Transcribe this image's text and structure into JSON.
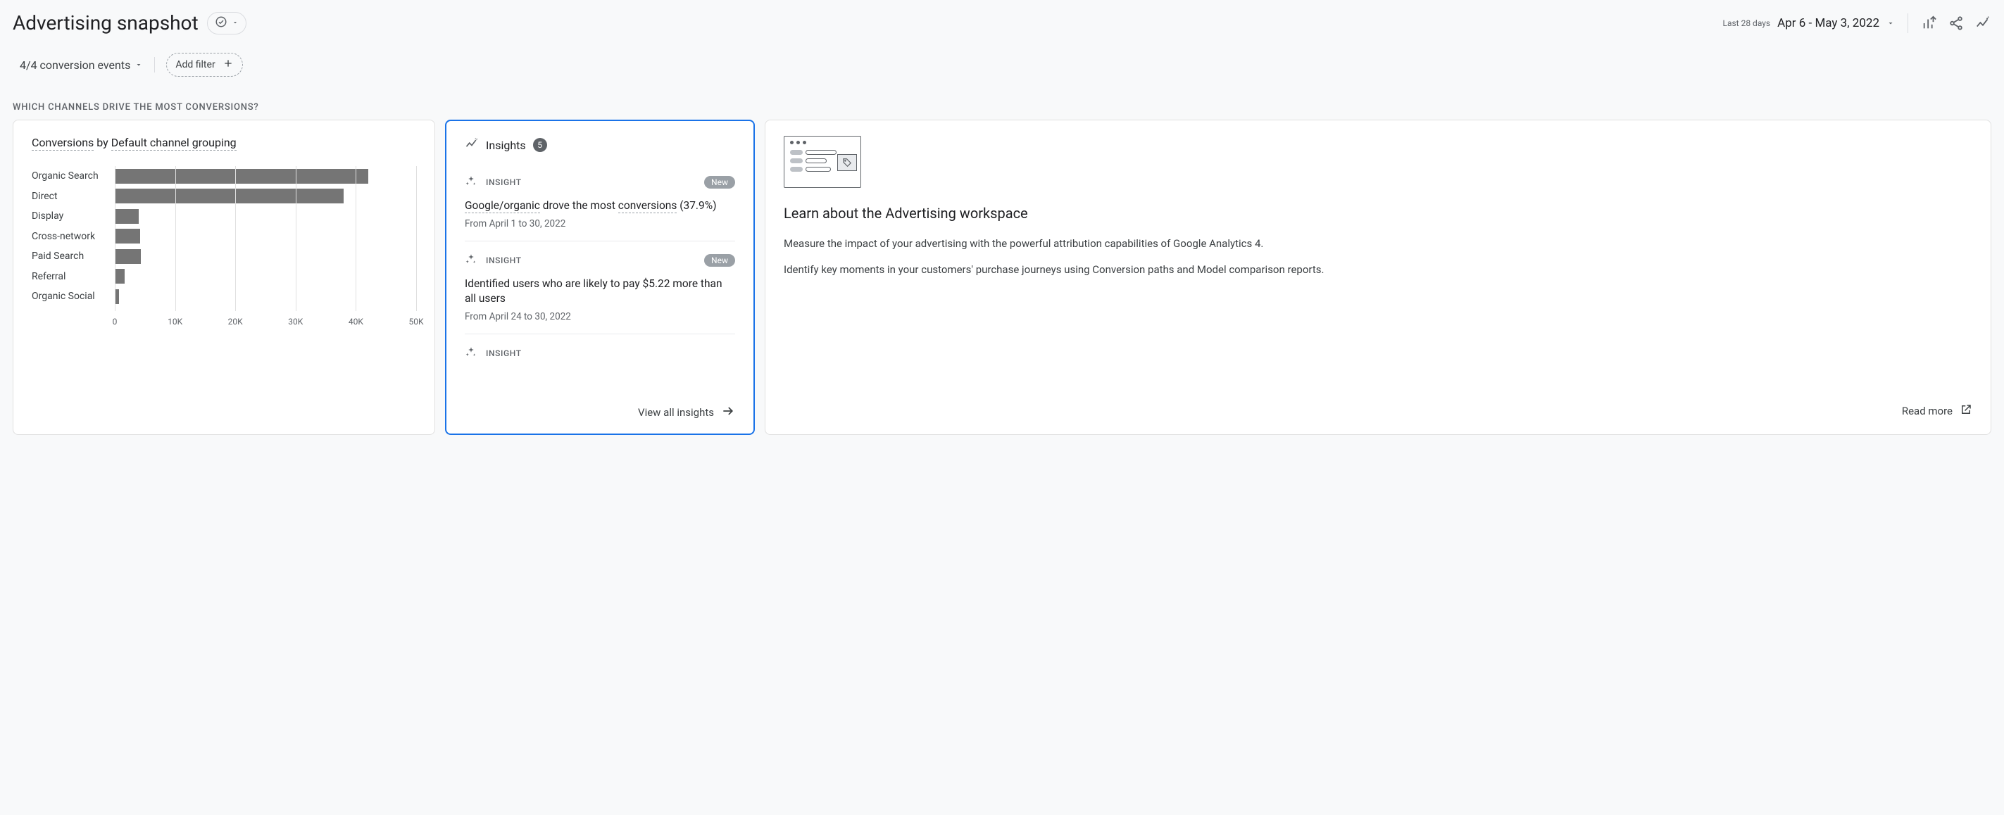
{
  "header": {
    "title": "Advertising snapshot",
    "date_label": "Last 28 days",
    "date_range": "Apr 6 - May 3, 2022"
  },
  "filters": {
    "conversion_events_label": "4/4 conversion events",
    "add_filter_label": "Add filter"
  },
  "section_heading": "WHICH CHANNELS DRIVE THE MOST CONVERSIONS?",
  "chart_card": {
    "title_metric": "Conversions",
    "title_connector": " by ",
    "title_dimension": "Default channel grouping"
  },
  "chart_data": {
    "type": "bar",
    "orientation": "horizontal",
    "categories": [
      "Organic Search",
      "Direct",
      "Display",
      "Cross-network",
      "Paid Search",
      "Referral",
      "Organic Social"
    ],
    "values": [
      42000,
      38000,
      4000,
      4200,
      4300,
      1600,
      700
    ],
    "xlabel": "",
    "ylabel": "",
    "xlim": [
      0,
      50000
    ],
    "x_ticks": [
      0,
      10000,
      20000,
      30000,
      40000,
      50000
    ],
    "x_tick_labels": [
      "0",
      "10K",
      "20K",
      "30K",
      "40K",
      "50K"
    ]
  },
  "insights_card": {
    "title": "Insights",
    "count": "5",
    "view_all_label": "View all insights",
    "items": [
      {
        "tag": "INSIGHT",
        "is_new": true,
        "title_prefix": "Google/organic",
        "title_mid": " drove the most ",
        "title_underlined": "conversions",
        "title_suffix": " (37.9%)",
        "subtitle": "From April 1 to 30, 2022"
      },
      {
        "tag": "INSIGHT",
        "is_new": true,
        "title_plain": "Identified users who are likely to pay $5.22 more than all users",
        "subtitle": "From April 24 to 30, 2022"
      },
      {
        "tag": "INSIGHT",
        "is_new": false
      }
    ],
    "new_badge_label": "New"
  },
  "learn_card": {
    "title": "Learn about the Advertising workspace",
    "body1": "Measure the impact of your advertising with the powerful attribution capabilities of Google Analytics 4.",
    "body2": "Identify key moments in your customers' purchase journeys using Conversion paths and Model comparison reports.",
    "read_more_label": "Read more"
  }
}
